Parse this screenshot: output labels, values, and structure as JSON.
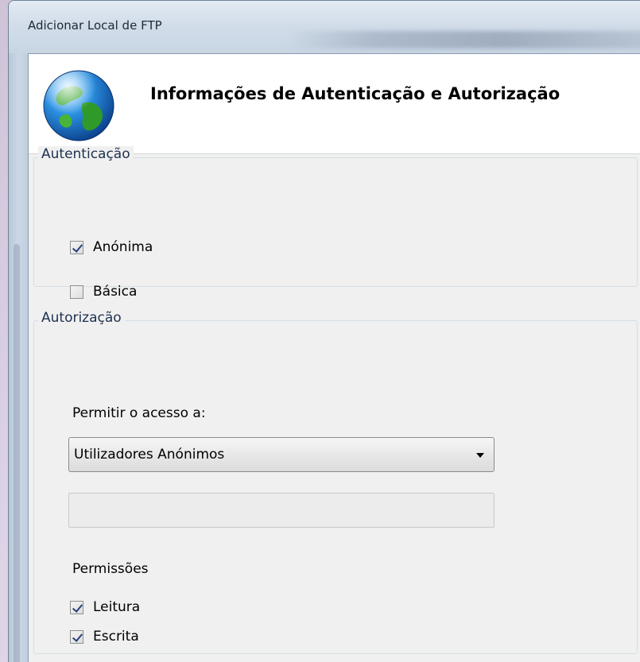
{
  "window": {
    "title": "Adicionar Local de FTP"
  },
  "header": {
    "title": "Informações de Autenticação e Autorização",
    "icon": "globe-icon"
  },
  "authentication": {
    "group_label": "Autenticação",
    "options": [
      {
        "label": "Anónima",
        "checked": true
      },
      {
        "label": "Básica",
        "checked": false
      }
    ]
  },
  "authorization": {
    "group_label": "Autorização",
    "access_label": "Permitir o acesso a:",
    "access_select": {
      "selected": "Utilizadores Anónimos"
    },
    "users_input": {
      "value": ""
    },
    "permissions_label": "Permissões",
    "permissions": [
      {
        "label": "Leitura",
        "checked": true
      },
      {
        "label": "Escrita",
        "checked": true
      }
    ]
  },
  "colors": {
    "header_bg": "#ffffff",
    "client_bg": "#f0f0f0",
    "check_mark": "#2a3e7c"
  }
}
